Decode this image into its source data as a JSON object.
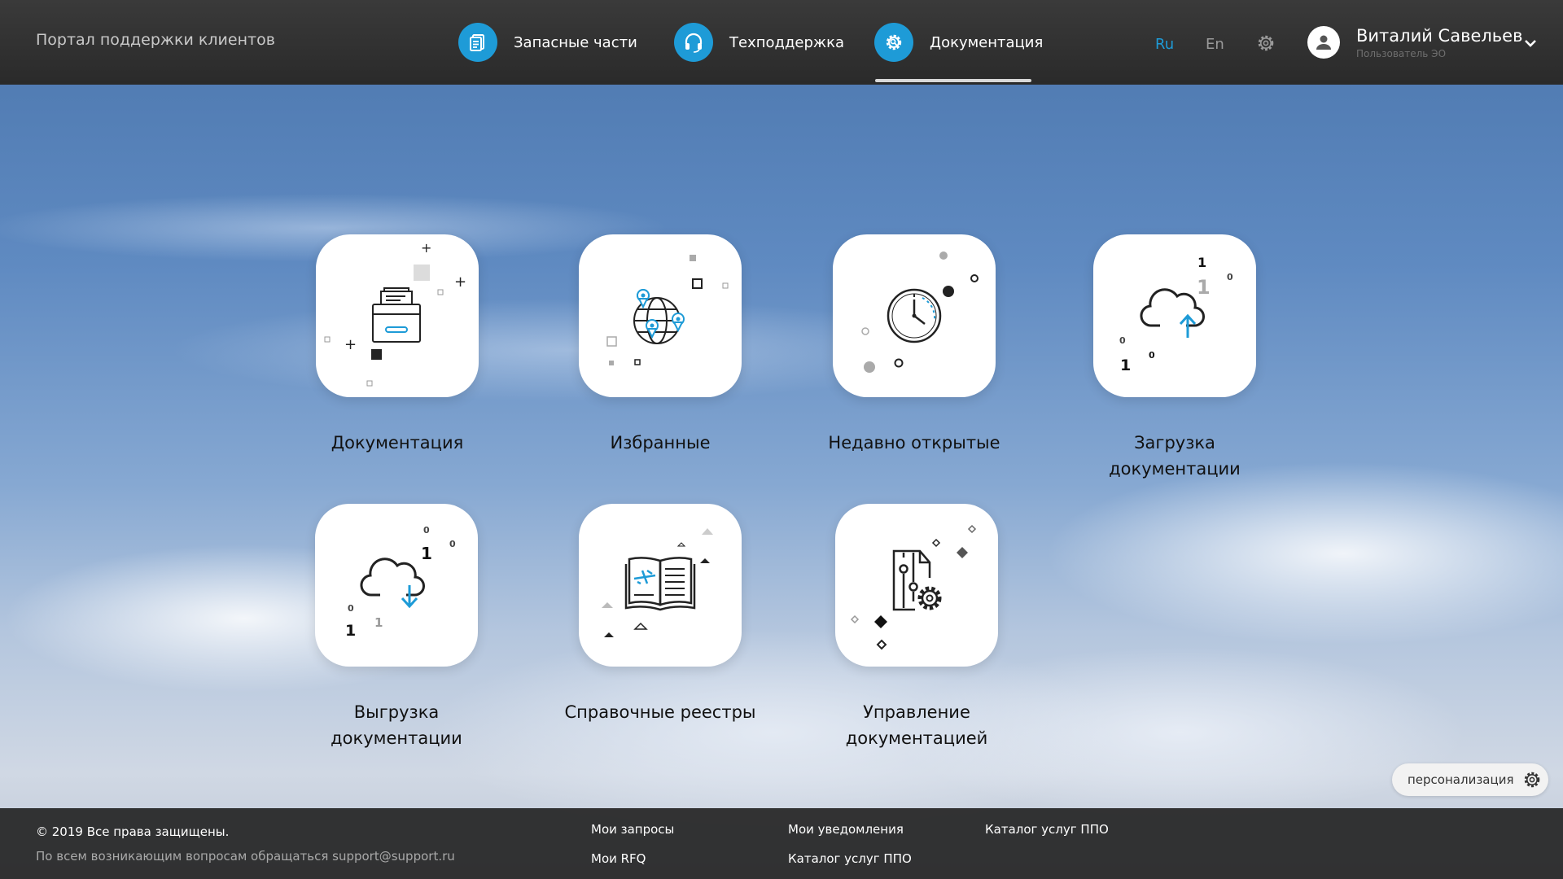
{
  "header": {
    "portal_title": "Портал поддержки клиентов",
    "tabs": [
      {
        "label": "Запасные части",
        "icon": "document-icon"
      },
      {
        "label": "Техподдержка",
        "icon": "headset-icon"
      },
      {
        "label": "Документация",
        "icon": "gear-search-icon",
        "active": true
      }
    ],
    "languages": [
      {
        "label": "Ru",
        "active": true
      },
      {
        "label": "En",
        "active": false
      }
    ],
    "user": {
      "name": "Виталий Савельев",
      "role": "Пользователь ЭО"
    }
  },
  "tiles": [
    {
      "label": "Документация",
      "icon": "file-cabinet-icon"
    },
    {
      "label": "Избранные",
      "icon": "globe-pins-icon"
    },
    {
      "label": "Недавно открытые",
      "icon": "clock-icon"
    },
    {
      "label": "Загрузка документации",
      "icon": "cloud-upload-icon"
    },
    {
      "label": "Выгрузка документации",
      "icon": "cloud-download-icon"
    },
    {
      "label": "Справочные реестры",
      "icon": "open-book-icon"
    },
    {
      "label": "Управление документацией",
      "icon": "document-gear-icon"
    }
  ],
  "personalization": {
    "label": "персонализация"
  },
  "footer": {
    "copyright": "© 2019 Все права защищены.",
    "contact": "По всем возникающим вопросам обращаться support@support.ru",
    "links": [
      "Мои запросы",
      "Мои RFQ",
      "Мои уведомления",
      "Каталог услуг ППО",
      "Каталог услуг ППО"
    ]
  },
  "colors": {
    "accent": "#1e9bd7",
    "header_bg": "#2e2e2e",
    "footer_bg": "#262626"
  }
}
